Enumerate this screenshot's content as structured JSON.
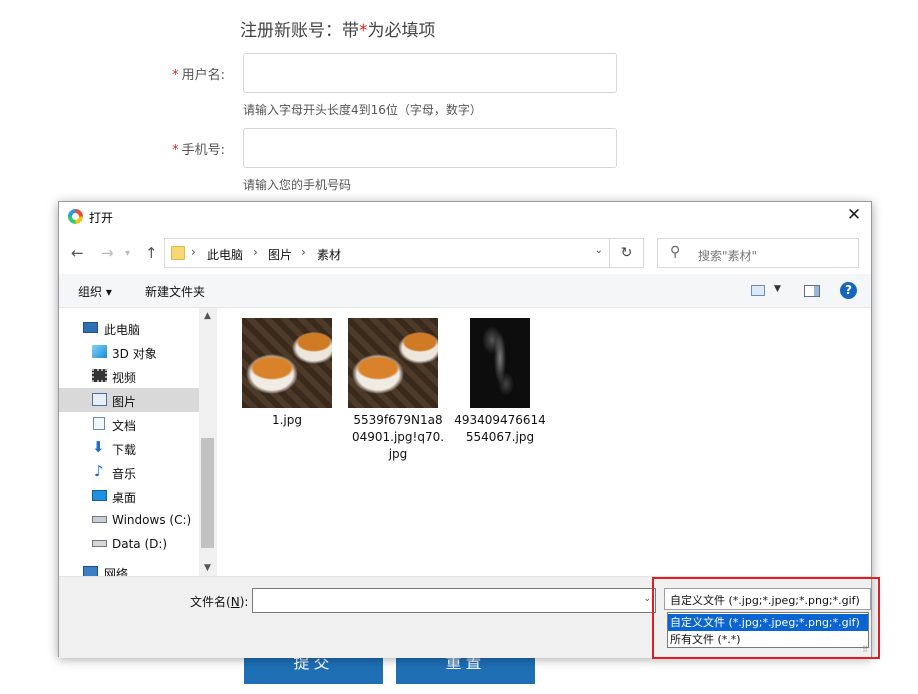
{
  "form": {
    "title_prefix": "注册新账号：带",
    "title_star": "*",
    "title_suffix": "为必填项",
    "req_mark": "*",
    "username_label": "用户名:",
    "username_hint": "请输入字母开头长度4到16位（字母，数字）",
    "phone_label": "手机号:",
    "phone_hint": "请输入您的手机号码",
    "submit_label": "提交",
    "reset_label": "重置"
  },
  "dialog": {
    "title": "打开",
    "close_glyph": "✕",
    "nav": {
      "back": "←",
      "forward": "→",
      "up": "↑"
    },
    "breadcrumb": [
      "此电脑",
      "图片",
      "素材"
    ],
    "breadcrumb_sep": "›",
    "refresh_glyph": "↻",
    "search_placeholder": "搜索\"素材\"",
    "toolbar": {
      "organize": "组织 ▾",
      "new_folder": "新建文件夹",
      "help": "?"
    },
    "nav_items": [
      {
        "label": "此电脑",
        "icon": "computer-icon"
      },
      {
        "label": "3D 对象",
        "icon": "cube-3d-icon"
      },
      {
        "label": "视频",
        "icon": "video-icon"
      },
      {
        "label": "图片",
        "icon": "picture-icon",
        "selected": true
      },
      {
        "label": "文档",
        "icon": "document-icon"
      },
      {
        "label": "下载",
        "icon": "download-icon"
      },
      {
        "label": "音乐",
        "icon": "music-icon"
      },
      {
        "label": "桌面",
        "icon": "desktop-icon"
      },
      {
        "label": "Windows (C:)",
        "icon": "drive-icon"
      },
      {
        "label": "Data (D:)",
        "icon": "drive-icon"
      },
      {
        "label": "网络",
        "icon": "network-icon"
      }
    ],
    "files": [
      {
        "name": "1.jpg",
        "thumb": "tea"
      },
      {
        "name": "5539f679N1a804901.jpg!q70.jpg",
        "thumb": "tea"
      },
      {
        "name": "493409476614554067.jpg",
        "thumb": "smoke"
      }
    ],
    "filename_label": "文件名",
    "filename_key": "N",
    "filename_value": "",
    "file_type_selected": "自定义文件 (*.jpg;*.jpeg;*.png;*.gif)",
    "file_type_options": [
      "自定义文件 (*.jpg;*.jpeg;*.png;*.gif)",
      "所有文件 (*.*)"
    ],
    "colors": {
      "selection": "#0a64d2",
      "highlight_border": "#e02020",
      "button": "#1f6fb5"
    }
  }
}
